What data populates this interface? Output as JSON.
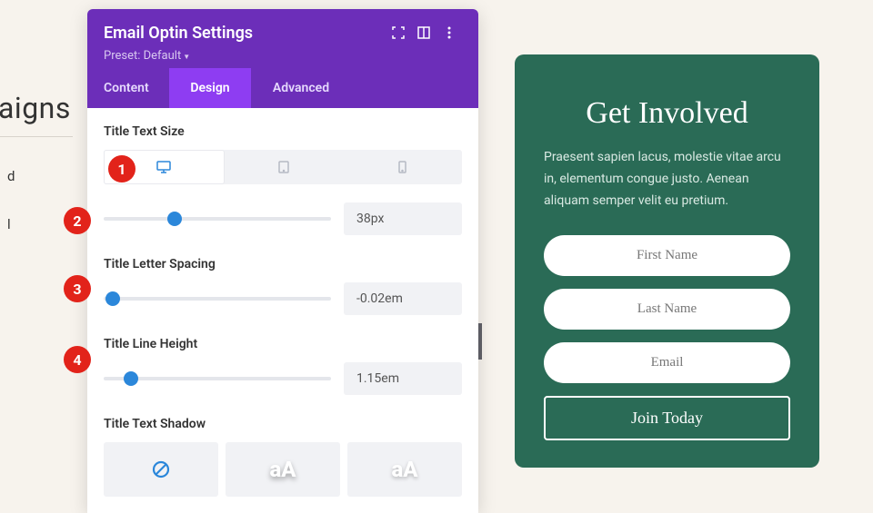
{
  "bg": {
    "title_fragment": "aigns",
    "side1": "d",
    "side2": "l"
  },
  "panel": {
    "title": "Email Optin Settings",
    "preset_label": "Preset: Default",
    "tabs": {
      "content": "Content",
      "design": "Design",
      "advanced": "Advanced"
    },
    "settings": {
      "text_size_label": "Title Text Size",
      "text_size_value": "38px",
      "text_size_thumb_pct": 31,
      "letter_spacing_label": "Title Letter Spacing",
      "letter_spacing_value": "-0.02em",
      "letter_spacing_thumb_pct": 4,
      "line_height_label": "Title Line Height",
      "line_height_value": "1.15em",
      "line_height_thumb_pct": 12,
      "text_shadow_label": "Title Text Shadow",
      "shadow_sample": "aA"
    }
  },
  "markers": {
    "m1": "1",
    "m2": "2",
    "m3": "3",
    "m4": "4"
  },
  "preview": {
    "title": "Get Involved",
    "desc": "Praesent sapien lacus, molestie vitae arcu in, elementum congue justo. Aenean aliquam semper velit eu pretium.",
    "first_name": "First Name",
    "last_name": "Last Name",
    "email": "Email",
    "button": "Join Today"
  }
}
